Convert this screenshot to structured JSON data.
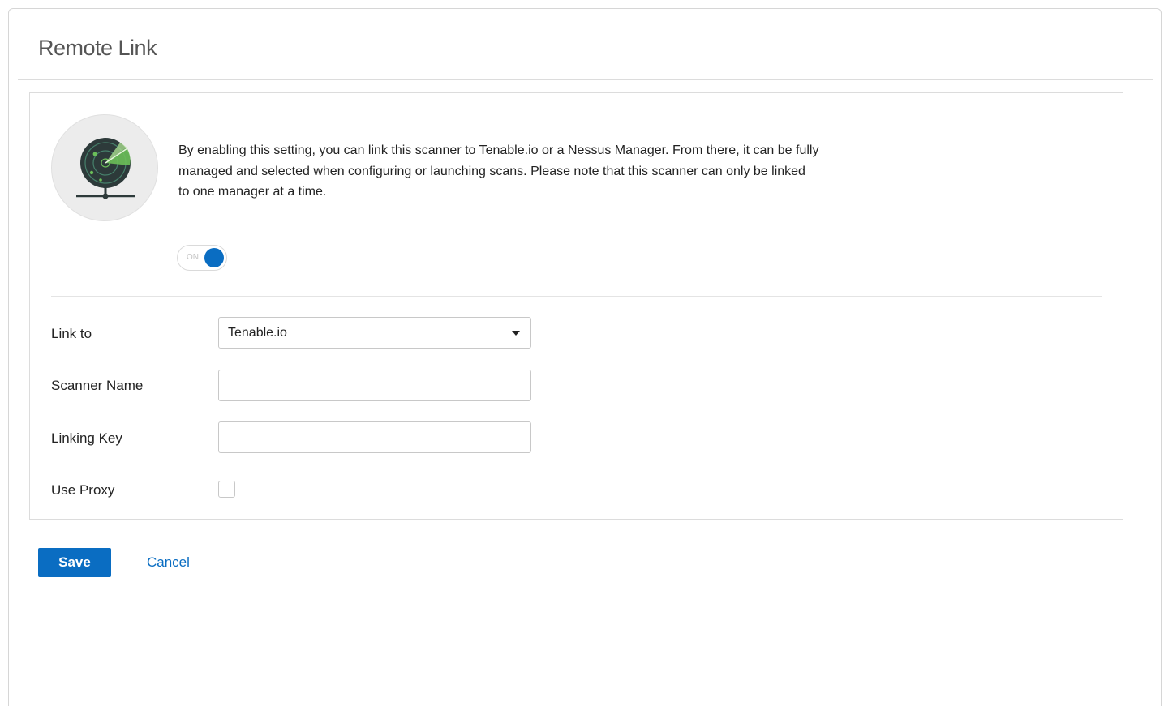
{
  "page": {
    "title": "Remote Link"
  },
  "panel": {
    "icon": "radar-scanner-icon",
    "description": "By enabling this setting, you can link this scanner to Tenable.io or a Nessus Manager. From there, it can be fully managed and selected when configuring or launching scans. Please note that this scanner can only be linked to one manager at a time.",
    "toggle": {
      "label": "ON",
      "state": "on"
    }
  },
  "form": {
    "link_to": {
      "label": "Link to",
      "value": "Tenable.io"
    },
    "scanner_name": {
      "label": "Scanner Name",
      "value": ""
    },
    "linking_key": {
      "label": "Linking Key",
      "value": ""
    },
    "use_proxy": {
      "label": "Use Proxy",
      "checked": false
    }
  },
  "actions": {
    "save_label": "Save",
    "cancel_label": "Cancel"
  },
  "colors": {
    "accent": "#0a6dc2",
    "radar_dark": "#2d3a3a",
    "radar_green": "#6bbf59"
  }
}
